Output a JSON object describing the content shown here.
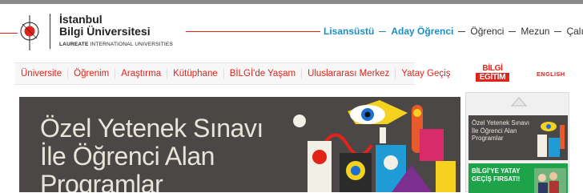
{
  "header": {
    "logo_line1": "İstanbul",
    "logo_line2": "Bilgi Üniversitesi",
    "logo_sub_bold": "LAUREATE",
    "logo_sub_rest": " INTERNATIONAL UNIVERSITIES",
    "top_nav": [
      {
        "label": "Lisansüstü",
        "style": "strong"
      },
      {
        "label": "Aday Öğrenci",
        "style": "strong"
      },
      {
        "label": "Öğrenci",
        "style": "plain"
      },
      {
        "label": "Mezun",
        "style": "plain"
      },
      {
        "label": "Çalışan",
        "style": "plain"
      }
    ]
  },
  "main_nav": {
    "items": [
      "Üniversite",
      "Öğrenim",
      "Araştırma",
      "Kütüphane",
      "BİLGİ'de Yaşam",
      "Uluslararası Merkez",
      "Yatay Geçiş"
    ]
  },
  "bilgi_egitim": {
    "line1": "BİLGİ",
    "line2": "EĞİTİM"
  },
  "language_link": "ENGLISH",
  "hero": {
    "title_line1": "Özel Yetenek Sınavı",
    "title_line2": "İle Öğrenci Alan",
    "title_line3": "Programlar"
  },
  "sidebar": {
    "card1_line1": "Özel Yetenek Sınavı",
    "card1_line2": "İle Öğrenci Alan",
    "card1_line3": "Programlar",
    "card2_line1": "BİLGİ'YE YATAY",
    "card2_line2": "GEÇİŞ FIRSATI!"
  },
  "colors": {
    "brand_red": "#e2231a",
    "accent_blue": "#1a8ec9",
    "hero_bg": "#4b4747",
    "promo_green": "#1ea34a"
  }
}
